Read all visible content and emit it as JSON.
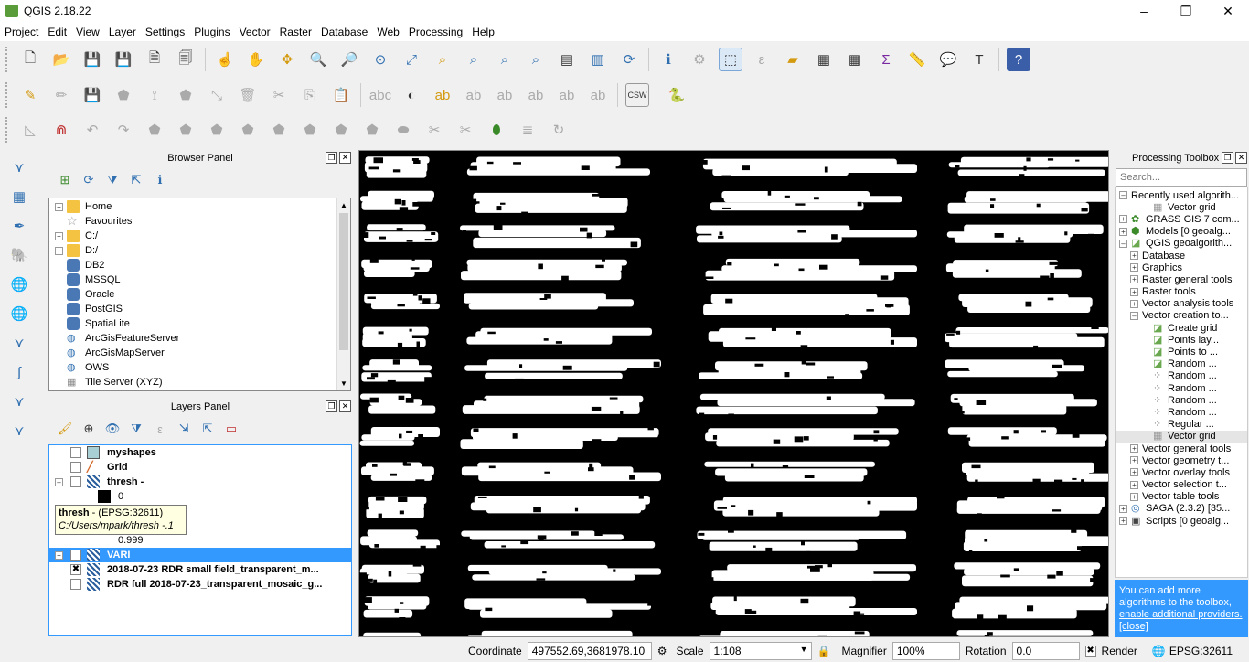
{
  "window": {
    "title": "QGIS 2.18.22",
    "minimize": "–",
    "restore": "❐",
    "close": "✕"
  },
  "menu": [
    "Project",
    "Edit",
    "View",
    "Layer",
    "Settings",
    "Plugins",
    "Vector",
    "Raster",
    "Database",
    "Web",
    "Processing",
    "Help"
  ],
  "browser_panel": {
    "title": "Browser Panel",
    "items": [
      {
        "label": "Home",
        "expand": "+",
        "icon": "folder-icon"
      },
      {
        "label": "Favourites",
        "expand": "",
        "icon": "star-icon"
      },
      {
        "label": "C:/",
        "expand": "+",
        "icon": "folder-icon"
      },
      {
        "label": "D:/",
        "expand": "+",
        "icon": "folder-icon"
      },
      {
        "label": "DB2",
        "expand": "",
        "icon": "db2-icon"
      },
      {
        "label": "MSSQL",
        "expand": "",
        "icon": "mssql-icon"
      },
      {
        "label": "Oracle",
        "expand": "",
        "icon": "oracle-icon"
      },
      {
        "label": "PostGIS",
        "expand": "",
        "icon": "postgis-icon"
      },
      {
        "label": "SpatiaLite",
        "expand": "",
        "icon": "spatialite-icon"
      },
      {
        "label": "ArcGisFeatureServer",
        "expand": "",
        "icon": "globe-icon"
      },
      {
        "label": "ArcGisMapServer",
        "expand": "",
        "icon": "globe-icon"
      },
      {
        "label": "OWS",
        "expand": "",
        "icon": "globe-icon"
      },
      {
        "label": "Tile Server (XYZ)",
        "expand": "",
        "icon": "grid-icon"
      }
    ]
  },
  "layers_panel": {
    "title": "Layers Panel",
    "rows": [
      {
        "label": "myshapes",
        "bold": true,
        "checked": "",
        "expand": "",
        "indent": 0,
        "icon": "polygon-layer-icon"
      },
      {
        "label": "Grid",
        "bold": true,
        "checked": "",
        "expand": "",
        "indent": 0,
        "icon": "line-layer-icon"
      },
      {
        "label": "thresh -",
        "bold": true,
        "checked": "",
        "expand": "–",
        "indent": 0,
        "icon": "raster-layer-icon"
      },
      {
        "label": "0",
        "bold": false,
        "checked": "",
        "expand": "",
        "indent": 1,
        "icon": "black-swatch-icon"
      },
      {
        "label": "",
        "bold": false,
        "checked": "",
        "expand": "",
        "indent": 1,
        "icon": ""
      },
      {
        "label": "0",
        "bold": false,
        "checked": "",
        "expand": "",
        "indent": 1,
        "icon": "black-swatch-icon"
      },
      {
        "label": "0.999",
        "bold": false,
        "checked": "",
        "expand": "",
        "indent": 1,
        "icon": ""
      },
      {
        "label": "VARI",
        "bold": true,
        "checked": "",
        "expand": "+",
        "indent": 0,
        "icon": "raster-layer-icon",
        "selected": true
      },
      {
        "label": "2018-07-23 RDR small field_transparent_m...",
        "bold": true,
        "checked": "✖",
        "expand": "",
        "indent": 0,
        "icon": "raster-layer-icon"
      },
      {
        "label": "RDR full 2018-07-23_transparent_mosaic_g...",
        "bold": true,
        "checked": "",
        "expand": "",
        "indent": 0,
        "icon": "raster-layer-icon"
      }
    ],
    "tooltip": {
      "name": "thresh",
      "crs": " - (EPSG:32611)",
      "path": "C:/Users/mpark/thresh -.1"
    }
  },
  "processing_toolbox": {
    "title": "Processing Toolbox",
    "search_placeholder": "Search...",
    "items": [
      {
        "label": "Recently used algorith...",
        "indent": 0,
        "expand": "–",
        "icon": ""
      },
      {
        "label": "Vector grid",
        "indent": 2,
        "expand": "",
        "icon": "grid-icon"
      },
      {
        "label": "GRASS GIS 7 com...",
        "indent": 0,
        "expand": "+",
        "icon": "grass-icon"
      },
      {
        "label": "Models [0 geoalg...",
        "indent": 0,
        "expand": "+",
        "icon": "models-icon"
      },
      {
        "label": "QGIS geoalgorith...",
        "indent": 0,
        "expand": "–",
        "icon": "qgis-icon"
      },
      {
        "label": "Database",
        "indent": 1,
        "expand": "+",
        "icon": ""
      },
      {
        "label": "Graphics",
        "indent": 1,
        "expand": "+",
        "icon": ""
      },
      {
        "label": "Raster general tools",
        "indent": 1,
        "expand": "+",
        "icon": ""
      },
      {
        "label": "Raster tools",
        "indent": 1,
        "expand": "+",
        "icon": ""
      },
      {
        "label": "Vector analysis tools",
        "indent": 1,
        "expand": "+",
        "icon": ""
      },
      {
        "label": "Vector creation to...",
        "indent": 1,
        "expand": "–",
        "icon": ""
      },
      {
        "label": "Create grid",
        "indent": 2,
        "expand": "",
        "icon": "qgis-icon"
      },
      {
        "label": "Points lay...",
        "indent": 2,
        "expand": "",
        "icon": "qgis-icon"
      },
      {
        "label": "Points to ...",
        "indent": 2,
        "expand": "",
        "icon": "qgis-icon"
      },
      {
        "label": "Random ...",
        "indent": 2,
        "expand": "",
        "icon": "qgis-icon"
      },
      {
        "label": "Random ...",
        "indent": 2,
        "expand": "",
        "icon": "dots-icon"
      },
      {
        "label": "Random ...",
        "indent": 2,
        "expand": "",
        "icon": "dots-icon"
      },
      {
        "label": "Random ...",
        "indent": 2,
        "expand": "",
        "icon": "dots-icon"
      },
      {
        "label": "Random ...",
        "indent": 2,
        "expand": "",
        "icon": "dots-icon"
      },
      {
        "label": "Regular ...",
        "indent": 2,
        "expand": "",
        "icon": "dots-icon"
      },
      {
        "label": "Vector grid",
        "indent": 2,
        "expand": "",
        "icon": "grid-icon",
        "selected": true
      },
      {
        "label": "Vector general tools",
        "indent": 1,
        "expand": "+",
        "icon": ""
      },
      {
        "label": "Vector geometry t...",
        "indent": 1,
        "expand": "+",
        "icon": ""
      },
      {
        "label": "Vector overlay tools",
        "indent": 1,
        "expand": "+",
        "icon": ""
      },
      {
        "label": "Vector selection t...",
        "indent": 1,
        "expand": "+",
        "icon": ""
      },
      {
        "label": "Vector table tools",
        "indent": 1,
        "expand": "+",
        "icon": ""
      },
      {
        "label": "SAGA (2.3.2) [35...",
        "indent": 0,
        "expand": "+",
        "icon": "saga-icon"
      },
      {
        "label": "Scripts [0 geoalg...",
        "indent": 0,
        "expand": "+",
        "icon": "scripts-icon"
      }
    ],
    "info": {
      "text": "You can add more algorithms to the toolbox,",
      "link": "enable additional providers.",
      "close": "[close]"
    }
  },
  "statusbar": {
    "coordinate_label": "Coordinate",
    "coordinate_value": "497552.69,3681978.10",
    "scale_label": "Scale",
    "scale_value": "1:108",
    "magnifier_label": "Magnifier",
    "magnifier_value": "100%",
    "rotation_label": "Rotation",
    "rotation_value": "0.0",
    "render_label": "Render",
    "render_checked": "✖",
    "crs": "EPSG:32611"
  },
  "colors": {
    "selection": "#3399ff",
    "map_foreground": "#ffffff",
    "map_background": "#000000"
  }
}
